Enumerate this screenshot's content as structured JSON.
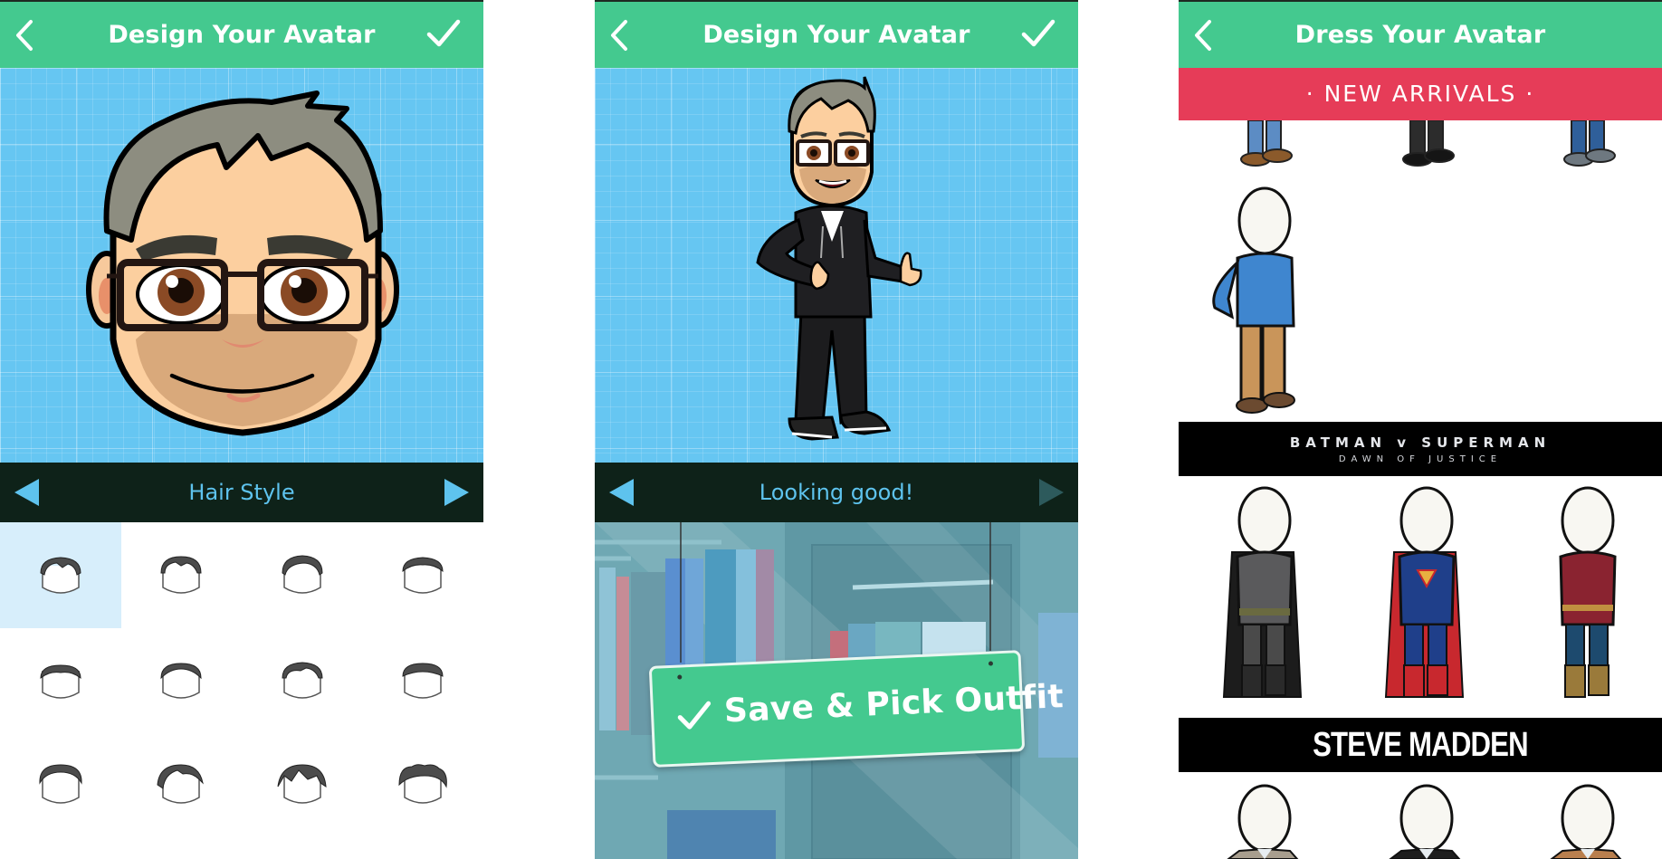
{
  "panels": [
    {
      "header": {
        "title": "Design Your Avatar",
        "back_icon": "chevron-left-icon",
        "confirm_icon": "checkmark-icon"
      },
      "nav": {
        "label": "Hair Style",
        "prev_icon": "triangle-left-icon",
        "next_icon": "triangle-right-icon",
        "next_enabled": true
      },
      "hair_styles": {
        "selected_index": 0,
        "count": 12,
        "columns": 4
      }
    },
    {
      "header": {
        "title": "Design Your Avatar",
        "back_icon": "chevron-left-icon",
        "confirm_icon": "checkmark-icon"
      },
      "nav": {
        "label": "Looking good!",
        "prev_icon": "triangle-left-icon",
        "next_icon": "triangle-right-icon",
        "next_enabled": false
      },
      "cta": {
        "label": "Save & Pick Outfit",
        "icon": "checkmark-icon"
      }
    },
    {
      "header": {
        "title": "Dress Your Avatar",
        "back_icon": "chevron-left-icon"
      },
      "sections": [
        {
          "title": "· NEW ARRIVALS ·",
          "outfits": [
            "Blue jeans with brown shoes",
            "Black pants with black shoes",
            "Dark jeans with grey shoes",
            "Blue sweater with khaki pants"
          ]
        },
        {
          "title": "BATMAN v SUPERMAN",
          "subtitle": "DAWN OF JUSTICE",
          "outfits": [
            "Batman",
            "Superman",
            "Wonder Woman"
          ]
        },
        {
          "title": "STEVE MADDEN",
          "outfits": [
            "Grey blazer",
            "Black blazer",
            "Brown blazer"
          ]
        }
      ]
    }
  ],
  "colors": {
    "header_green": "#44c98f",
    "canvas_blue": "#66c6f2",
    "nav_dark": "#0e2219",
    "nav_text": "#5ec3ee",
    "new_arrivals_red": "#e63c58",
    "selected_cell": "#d7eefb"
  }
}
